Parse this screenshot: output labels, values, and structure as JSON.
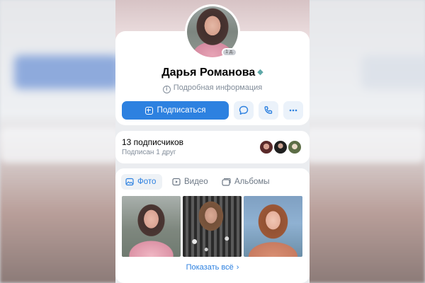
{
  "profile": {
    "name": "Дарья Романова",
    "status_badge": "1 д.",
    "info_link": "Подробная информация"
  },
  "actions": {
    "subscribe_label": "Подписаться",
    "message_icon": "message-icon",
    "call_icon": "phone-icon",
    "more_icon": "more-icon"
  },
  "followers": {
    "title": "13 подписчиков",
    "subtitle": "Подписан 1 друг"
  },
  "media": {
    "tabs": [
      {
        "label": "Фото",
        "icon": "photo-icon",
        "active": true
      },
      {
        "label": "Видео",
        "icon": "video-icon",
        "active": false
      },
      {
        "label": "Альбомы",
        "icon": "albums-icon",
        "active": false
      }
    ],
    "show_all": "Показать всё"
  },
  "colors": {
    "accent": "#2d81e0",
    "secondary_text": "#818c99",
    "background": "#ebedf0"
  }
}
